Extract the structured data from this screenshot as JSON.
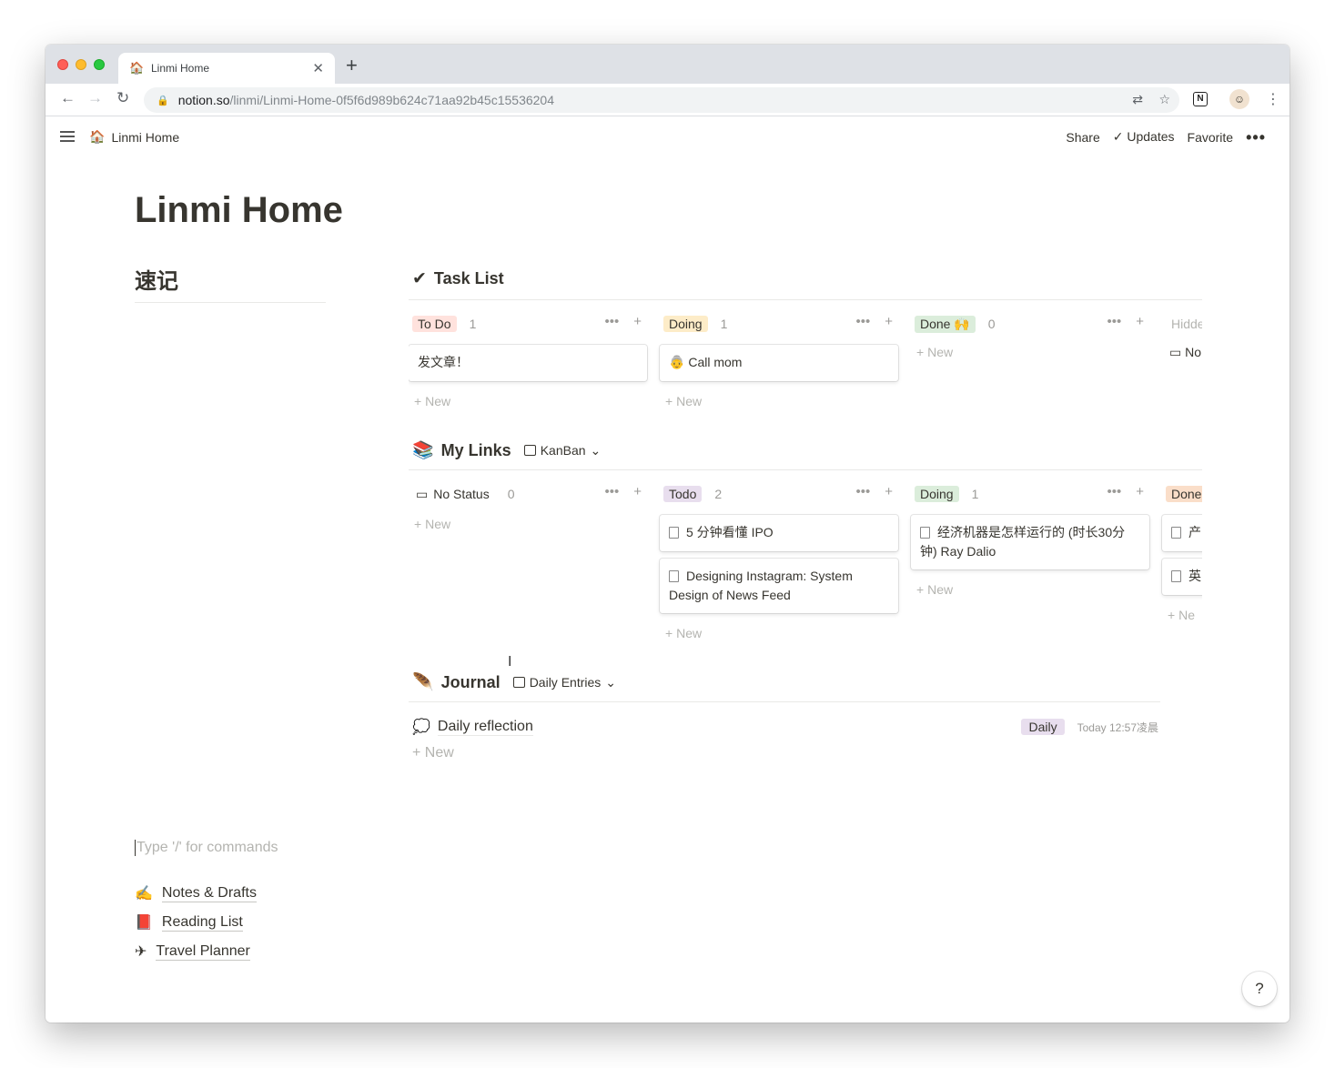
{
  "browser": {
    "tab_title": "Linmi Home",
    "tab_favicon": "🏠",
    "close_glyph": "✕",
    "new_tab_glyph": "+",
    "url_host": "notion.so",
    "url_path": "/linmi/Linmi-Home-0f5f6d989b624c71aa92b45c15536204",
    "icons": [
      "back-icon",
      "forward-icon",
      "reload-icon",
      "lock-icon",
      "translate-icon",
      "star-icon",
      "notion-extension-icon",
      "profile-avatar",
      "menu-kebab-icon"
    ],
    "ext_label": "N"
  },
  "header": {
    "breadcrumb_icon": "🏠",
    "breadcrumb_title": "Linmi Home",
    "share": "Share",
    "updates": "Updates",
    "favorite": "Favorite",
    "more": "•••"
  },
  "page": {
    "title": "Linmi Home",
    "quick_note": "速记"
  },
  "task_list": {
    "icon": "✔",
    "title": "Task List",
    "columns": [
      {
        "tag": "To Do",
        "tag_bg": "#ffe2dd",
        "count": "1",
        "cards": [
          {
            "icon": "",
            "text": "发文章！"
          }
        ],
        "new": "New"
      },
      {
        "tag": "Doing",
        "tag_bg": "#fdecc8",
        "count": "1",
        "cards": [
          {
            "icon": "👵",
            "text": "Call mom"
          }
        ],
        "new": "New"
      },
      {
        "tag": "Done 🙌",
        "tag_bg": "#dbeddb",
        "count": "0",
        "cards": [],
        "new": "New"
      },
      {
        "tag": "Hidden",
        "tag_bg": "transparent",
        "count": "",
        "cards": [],
        "partial_label": "No"
      }
    ]
  },
  "my_links": {
    "icon": "📚",
    "title": "My Links",
    "view_name": "KanBan",
    "columns": [
      {
        "tag": "No Status",
        "tag_bg": "transparent",
        "count": "0",
        "cards": [],
        "new": "New"
      },
      {
        "tag": "Todo",
        "tag_bg": "#e8deee",
        "count": "2",
        "cards": [
          {
            "text": "5 分钟看懂 IPO"
          },
          {
            "text": "Designing Instagram: System Design of News Feed"
          }
        ],
        "new": "New"
      },
      {
        "tag": "Doing",
        "tag_bg": "#dbeddb",
        "count": "1",
        "cards": [
          {
            "text": "经济机器是怎样运行的 (时长30分钟) Ray Dalio"
          }
        ],
        "new": "New"
      },
      {
        "tag": "Done",
        "tag_bg": "#fadec9",
        "count": "",
        "cards": [
          {
            "text": "产"
          },
          {
            "text": "英"
          }
        ],
        "new": "Ne"
      }
    ]
  },
  "journal": {
    "icon": "🪶",
    "title": "Journal",
    "view_name": "Daily Entries",
    "entry_icon": "💭",
    "entry_name": "Daily reflection",
    "entry_tag": "Daily",
    "entry_time": "Today 12:57凌晨",
    "new": "New"
  },
  "editor": {
    "placeholder": "Type '/' for commands"
  },
  "page_links": [
    {
      "icon": "✍️",
      "label": "Notes & Drafts"
    },
    {
      "icon": "📕",
      "label": "Reading List"
    },
    {
      "icon": "✈",
      "label": "Travel Planner"
    }
  ],
  "help": "?"
}
